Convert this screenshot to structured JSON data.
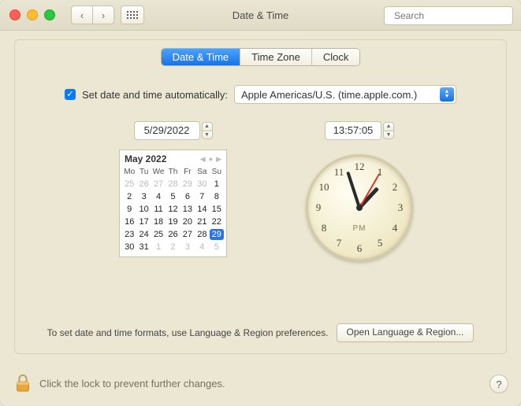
{
  "window": {
    "title": "Date & Time"
  },
  "search": {
    "placeholder": "Search"
  },
  "tabs": {
    "date_time": "Date & Time",
    "time_zone": "Time Zone",
    "clock": "Clock"
  },
  "auto": {
    "label": "Set date and time automatically:",
    "server": "Apple Americas/U.S. (time.apple.com.)",
    "checked": true
  },
  "date_field": "5/29/2022",
  "time_field": "13:57:05",
  "calendar": {
    "month_label": "May 2022",
    "day_headers": [
      "Mo",
      "Tu",
      "We",
      "Th",
      "Fr",
      "Sa",
      "Su"
    ],
    "weeks": [
      [
        {
          "n": "25",
          "dim": true
        },
        {
          "n": "26",
          "dim": true
        },
        {
          "n": "27",
          "dim": true
        },
        {
          "n": "28",
          "dim": true
        },
        {
          "n": "29",
          "dim": true
        },
        {
          "n": "30",
          "dim": true
        },
        {
          "n": "1"
        }
      ],
      [
        {
          "n": "2"
        },
        {
          "n": "3"
        },
        {
          "n": "4"
        },
        {
          "n": "5"
        },
        {
          "n": "6"
        },
        {
          "n": "7"
        },
        {
          "n": "8"
        }
      ],
      [
        {
          "n": "9"
        },
        {
          "n": "10"
        },
        {
          "n": "11"
        },
        {
          "n": "12"
        },
        {
          "n": "13"
        },
        {
          "n": "14"
        },
        {
          "n": "15"
        }
      ],
      [
        {
          "n": "16"
        },
        {
          "n": "17"
        },
        {
          "n": "18"
        },
        {
          "n": "19"
        },
        {
          "n": "20"
        },
        {
          "n": "21"
        },
        {
          "n": "22"
        }
      ],
      [
        {
          "n": "23"
        },
        {
          "n": "24"
        },
        {
          "n": "25"
        },
        {
          "n": "26"
        },
        {
          "n": "27"
        },
        {
          "n": "28"
        },
        {
          "n": "29",
          "sel": true
        }
      ],
      [
        {
          "n": "30"
        },
        {
          "n": "31"
        },
        {
          "n": "1",
          "dim": true
        },
        {
          "n": "2",
          "dim": true
        },
        {
          "n": "3",
          "dim": true
        },
        {
          "n": "4",
          "dim": true
        },
        {
          "n": "5",
          "dim": true
        }
      ]
    ]
  },
  "clock": {
    "numerals": [
      "12",
      "1",
      "2",
      "3",
      "4",
      "5",
      "6",
      "7",
      "8",
      "9",
      "10",
      "11"
    ],
    "period": "PM"
  },
  "footer": {
    "hint": "To set date and time formats, use Language & Region preferences.",
    "button": "Open Language & Region..."
  },
  "lock": {
    "text": "Click the lock to prevent further changes."
  },
  "help": "?"
}
